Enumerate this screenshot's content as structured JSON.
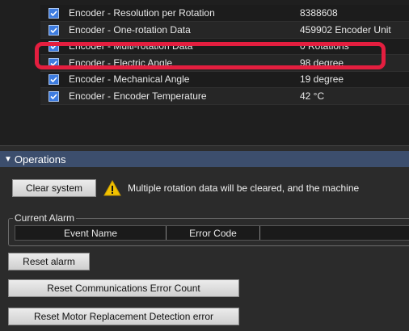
{
  "monitor": {
    "rows": [
      {
        "name": "Encoder - Resolution per Rotation",
        "value": "8388608"
      },
      {
        "name": "Encoder - One-rotation Data",
        "value": "459902 Encoder Unit"
      },
      {
        "name": "Encoder - Multi-rotation Data",
        "value": "0 Rotations"
      },
      {
        "name": "Encoder - Electric Angle",
        "value": "98 degree"
      },
      {
        "name": "Encoder - Mechanical Angle",
        "value": "19 degree"
      },
      {
        "name": "Encoder - Encoder Temperature",
        "value": "42 °C"
      }
    ],
    "highlight_color": "#e41e3f"
  },
  "operations": {
    "title": "Operations",
    "clear_system_label": "Clear system",
    "warning_text": "Multiple rotation data will be cleared, and the machine",
    "current_alarm": {
      "legend": "Current Alarm",
      "columns": [
        "Event Name",
        "Error Code"
      ]
    },
    "reset_alarm_label": "Reset alarm",
    "reset_comm_label": "Reset Communications Error Count",
    "reset_motor_label": "Reset Motor Replacement Detection error"
  },
  "colors": {
    "header_bg": "#3c4e6d",
    "checkbox": "#3d7ce0",
    "warning": "#f2c200"
  }
}
